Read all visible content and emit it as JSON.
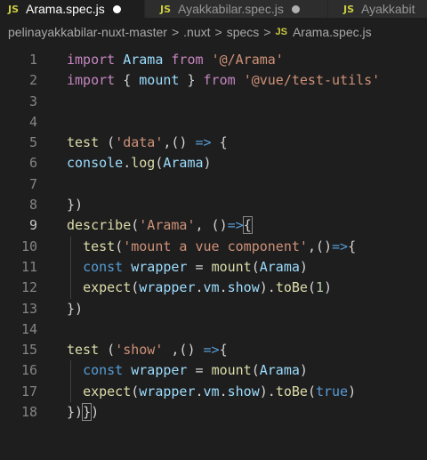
{
  "tabs": [
    {
      "badge": "JS",
      "name": "Arama.spec.js",
      "active": true
    },
    {
      "badge": "JS",
      "name": "Ayakkabilar.spec.js",
      "active": false
    },
    {
      "badge": "JS",
      "name": "Ayakkabit",
      "active": false
    }
  ],
  "breadcrumb": {
    "items": [
      "pelinayakkabilar-nuxt-master",
      ".nuxt",
      "specs"
    ],
    "file_badge": "JS",
    "file": "Arama.spec.js",
    "separator": ">"
  },
  "editor": {
    "line_numbers": [
      "1",
      "2",
      "3",
      "4",
      "5",
      "6",
      "7",
      "8",
      "9",
      "10",
      "11",
      "12",
      "13",
      "14",
      "15",
      "16",
      "17",
      "18"
    ],
    "current_line": 9,
    "lines": [
      {
        "t": "import Arama from '@/Arama'"
      },
      {
        "t": "import { mount } from '@vue/test-utils'"
      },
      {
        "t": ""
      },
      {
        "t": ""
      },
      {
        "t": "test ('data',() => {"
      },
      {
        "t": "console.log(Arama)"
      },
      {
        "t": ""
      },
      {
        "t": "})"
      },
      {
        "t": "describe('Arama', ()=>{"
      },
      {
        "t": "  test('mount a vue component',()=>{"
      },
      {
        "t": "  const wrapper = mount(Arama)"
      },
      {
        "t": "  expect(wrapper.vm.show).toBe(1)"
      },
      {
        "t": "})"
      },
      {
        "t": ""
      },
      {
        "t": "test ('show' ,() =>{"
      },
      {
        "t": "  const wrapper = mount(Arama)"
      },
      {
        "t": "  expect(wrapper.vm.show).toBe(true)"
      },
      {
        "t": "})})"
      }
    ]
  },
  "colors": {
    "keyword": "#c586c0",
    "storage": "#569cd6",
    "variable": "#9cdcfe",
    "function": "#dcdcaa",
    "string": "#ce9178",
    "number": "#b5cea8",
    "js_badge": "#cbcb41"
  }
}
